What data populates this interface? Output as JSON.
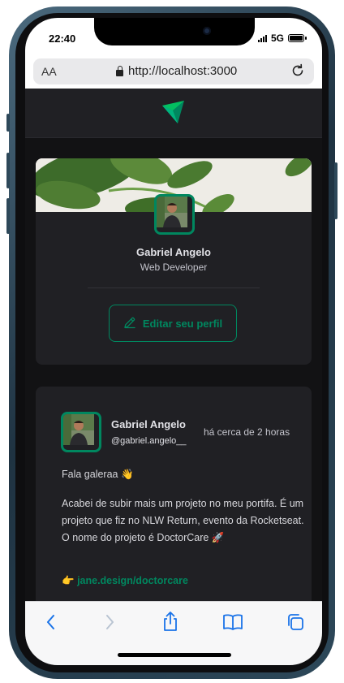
{
  "status_bar": {
    "time": "22:40",
    "network": "5G"
  },
  "browser": {
    "text_size_label": "AA",
    "url": "http://localhost:3000",
    "toolbar": [
      "back-icon",
      "forward-icon",
      "share-icon",
      "bookmarks-icon",
      "tabs-icon"
    ]
  },
  "colors": {
    "accent": "#00875f",
    "card": "#202024",
    "background": "#121214"
  },
  "profile": {
    "name": "Gabriel Angelo",
    "role": "Web Developer",
    "edit_label": "Editar seu perfil"
  },
  "post": {
    "author": "Gabriel Angelo",
    "handle": "@gabriel.angelo__",
    "time": "há cerca de 2 horas",
    "greeting": "Fala galeraa 👋",
    "body": "Acabei de subir mais um projeto no meu portifa. É um projeto que fiz no NLW Return, evento da Rocketseat. O nome do projeto é DoctorCare 🚀",
    "link_prefix": "👉",
    "link": "jane.design/doctorcare"
  }
}
